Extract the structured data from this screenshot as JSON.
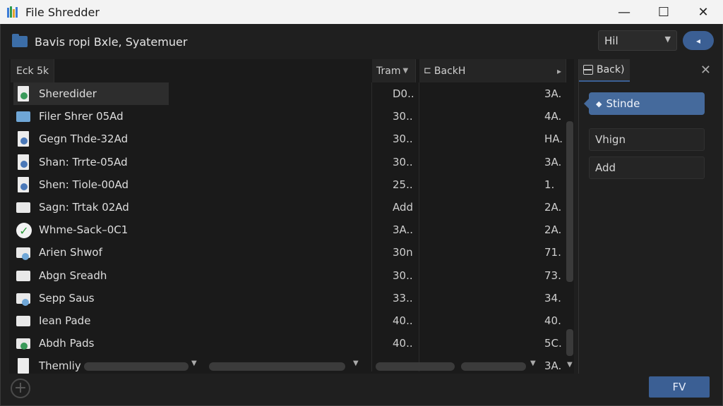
{
  "window": {
    "title": "File Shredder",
    "minimize_label": "—",
    "maximize_label": "☐",
    "close_label": "✕"
  },
  "pathbar": {
    "path": "Bavis ropi Bxle, Syatemuer",
    "filter_value": "Hil",
    "go_label": "◂"
  },
  "columns": {
    "name": "Eck 5k",
    "time": "Tram",
    "back": "BackH"
  },
  "files": [
    {
      "name": "Sheredider",
      "time": "D0..",
      "size": "3A.",
      "icon": "shield-file-icon"
    },
    {
      "name": "Filer Shrer 05Ad",
      "time": "30..",
      "size": "4A.",
      "icon": "image-file-icon"
    },
    {
      "name": "Gegn Thde-32Ad",
      "time": "30..",
      "size": "HA.",
      "icon": "disc-file-icon"
    },
    {
      "name": "Shan: Trrte-05Ad",
      "time": "30..",
      "size": "3A.",
      "icon": "disc-file-icon"
    },
    {
      "name": "Shen: Tiole-00Ad",
      "time": "25..",
      "size": "1.",
      "icon": "disc-file-icon"
    },
    {
      "name": "Sagn: Trtak 02Ad",
      "time": "Add",
      "size": "2A.",
      "icon": "folder-icon"
    },
    {
      "name": "Whme-Sack–0C1",
      "time": "3A..",
      "size": "2A.",
      "icon": "check-icon"
    },
    {
      "name": "Arien Shwof",
      "time": "30n",
      "size": "71.",
      "icon": "folder-blue-icon"
    },
    {
      "name": "Abgn Sreadh",
      "time": "30..",
      "size": "73.",
      "icon": "folder-icon"
    },
    {
      "name": "Sepp Saus",
      "time": "33..",
      "size": "34.",
      "icon": "folder-blue-icon"
    },
    {
      "name": "Iean Pade",
      "time": "40..",
      "size": "40.",
      "icon": "folder-icon"
    },
    {
      "name": "Abdh Pads",
      "time": "40..",
      "size": "5C.",
      "icon": "green-folder-icon"
    },
    {
      "name": "Themliy",
      "time": "",
      "size": "3A.",
      "icon": "doc-file-icon"
    }
  ],
  "sidepanel": {
    "tab_label": "Back)",
    "close_label": "✕",
    "shred_label": "Stinde",
    "field1": "Vhign",
    "field2": "Add"
  },
  "footer": {
    "add_label": "+",
    "fv_label": "FV"
  },
  "colors": {
    "accent": "#3b5f94",
    "background": "#1f1f1f",
    "titlebar": "#f3f3f3"
  }
}
